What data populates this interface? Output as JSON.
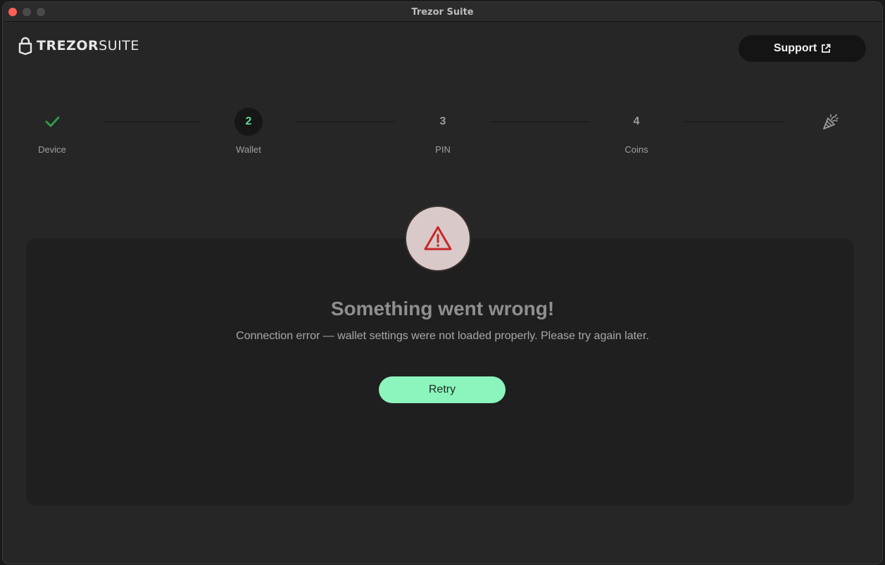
{
  "window": {
    "title": "Trezor Suite"
  },
  "header": {
    "logo_trezor": "TREZOR",
    "logo_suite": "SUITE",
    "support_label": "Support"
  },
  "steps": [
    {
      "mark": "",
      "label": "Device",
      "status": "done"
    },
    {
      "mark": "2",
      "label": "Wallet",
      "status": "active"
    },
    {
      "mark": "3",
      "label": "PIN",
      "status": "pending"
    },
    {
      "mark": "4",
      "label": "Coins",
      "status": "pending"
    },
    {
      "mark": "",
      "label": "",
      "status": "final"
    }
  ],
  "error": {
    "title": "Something went wrong!",
    "description": "Connection error — wallet settings were not loaded properly. Please try again later.",
    "retry_label": "Retry"
  },
  "colors": {
    "accent_green": "#8cf5bd",
    "check_green": "#2e9e48",
    "warning_red": "#c62828"
  }
}
